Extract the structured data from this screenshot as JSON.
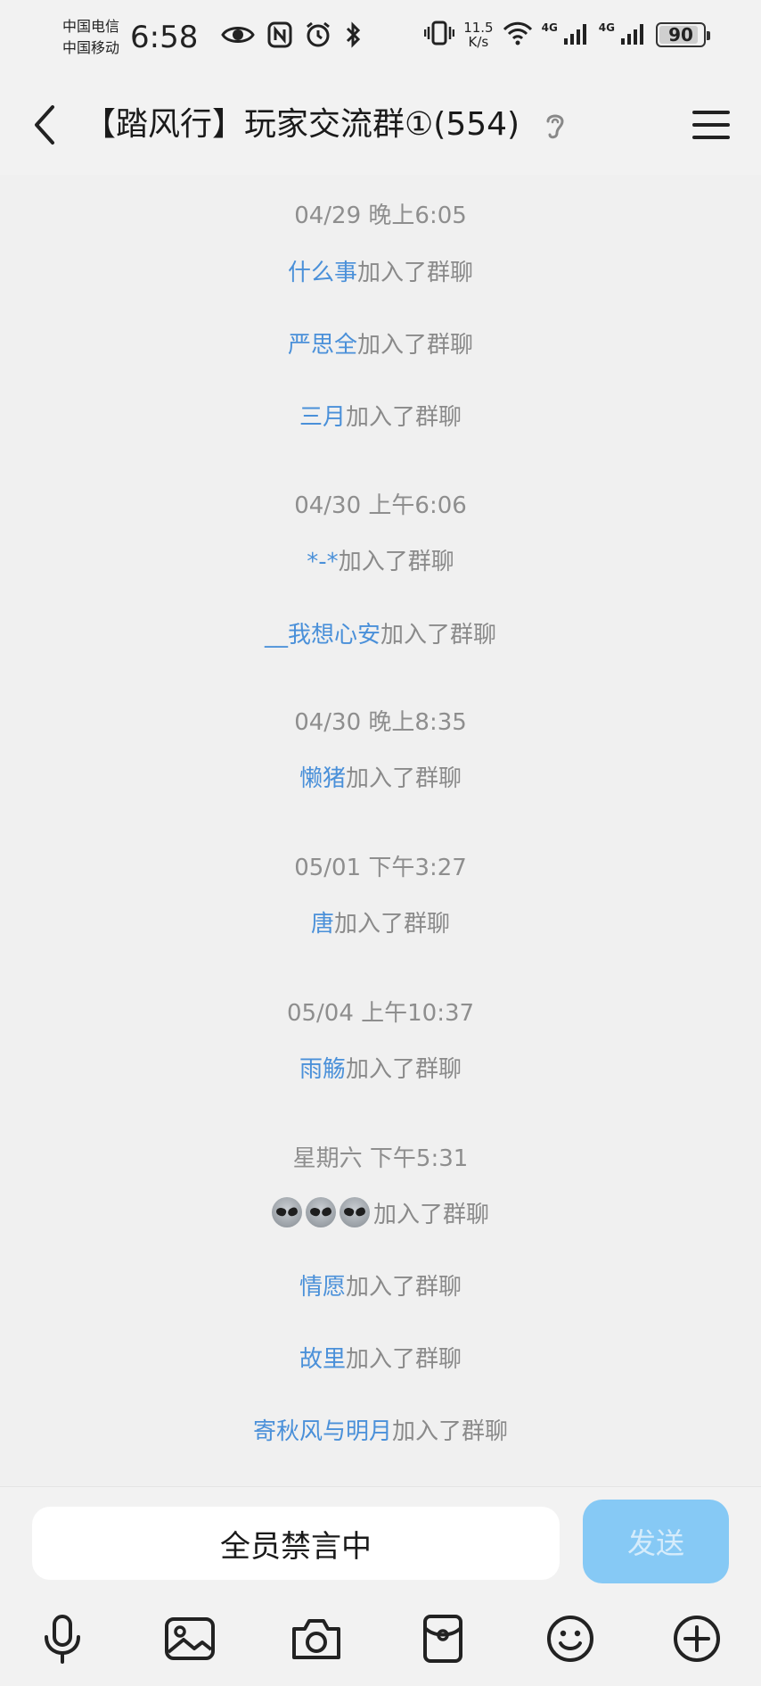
{
  "status_bar": {
    "carrier_1": "中国电信",
    "carrier_2": "中国移动",
    "time": "6:58",
    "net_speed_value": "11.5",
    "net_speed_unit": "K/s",
    "network_1": "4G",
    "network_2": "4G",
    "battery": "90",
    "battery_level": 0.9,
    "icons": [
      "eye-icon",
      "nfc-icon",
      "alarm-icon",
      "bluetooth-icon",
      "vibrate-icon",
      "wifi-icon",
      "signal-icon",
      "signal-icon",
      "battery-icon"
    ]
  },
  "header": {
    "title": "【踏风行】玩家交流群①(554)",
    "back_icon": "chevron-left-icon",
    "ear_icon": "ear-icon",
    "menu_icon": "hamburger-menu-icon"
  },
  "messages": {
    "joined_suffix": "加入了群聊",
    "items": [
      {
        "type": "time",
        "text": "04/29 晚上6:05"
      },
      {
        "type": "join",
        "name": "什么事"
      },
      {
        "type": "join",
        "name": "严思全"
      },
      {
        "type": "join",
        "name": "三月"
      },
      {
        "type": "time",
        "text": "04/30 上午6:06"
      },
      {
        "type": "join",
        "name": "*-*"
      },
      {
        "type": "join",
        "name": "__我想心安"
      },
      {
        "type": "time",
        "text": "04/30 晚上8:35"
      },
      {
        "type": "join",
        "name": "懒猪"
      },
      {
        "type": "time",
        "text": "05/01 下午3:27"
      },
      {
        "type": "join",
        "name": "唐"
      },
      {
        "type": "time",
        "text": "05/04 上午10:37"
      },
      {
        "type": "join",
        "name": "雨觞"
      },
      {
        "type": "time",
        "text": "星期六 下午5:31"
      },
      {
        "type": "join",
        "name": "👽👽👽"
      },
      {
        "type": "join",
        "name": "情愿"
      },
      {
        "type": "join",
        "name": "故里"
      },
      {
        "type": "join",
        "name": "寄秋风与明月"
      }
    ]
  },
  "input_bar": {
    "field_text": "全员禁言中",
    "send_label": "发送",
    "send_color": "#86c9f5",
    "tools": [
      "microphone-icon",
      "image-icon",
      "camera-icon",
      "red-packet-icon",
      "emoji-icon",
      "plus-icon"
    ]
  },
  "colors": {
    "background": "#f0f0f0",
    "name_link": "#4a90d9",
    "system_text": "#8a8a8a"
  }
}
